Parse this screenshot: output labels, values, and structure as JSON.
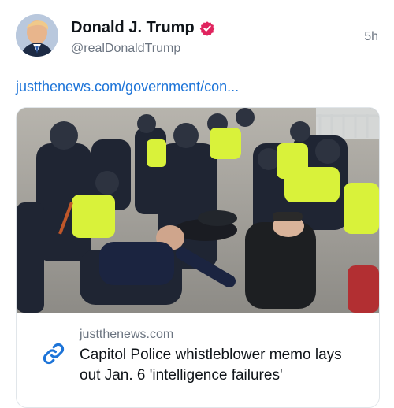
{
  "tweet": {
    "display_name": "Donald J. Trump",
    "handle": "@realDonaldTrump",
    "time": "5h",
    "link_text": "justthenews.com/government/con..."
  },
  "card": {
    "domain": "justthenews.com",
    "headline": "Capitol Police whistleblower memo lays out Jan. 6 'intelligence failures'"
  },
  "colors": {
    "link": "#1d74d8",
    "verified_badge": "#e0245e",
    "secondary_text": "#6b7480"
  },
  "icons": {
    "verified": "verified-badge-icon",
    "link": "link-icon"
  }
}
